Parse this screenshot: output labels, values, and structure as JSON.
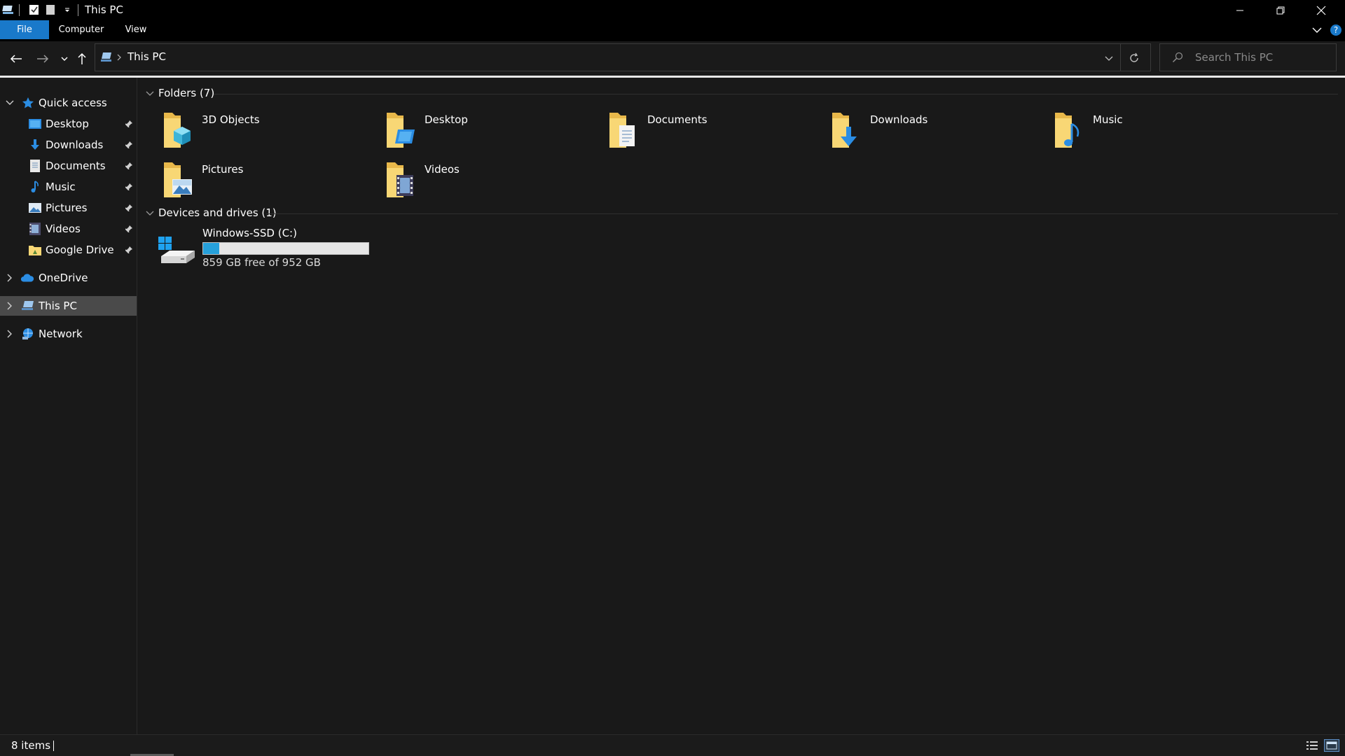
{
  "window": {
    "title": "This PC",
    "controls": {
      "minimize": "minimize-icon",
      "maximize": "restore-icon",
      "close": "close-icon"
    }
  },
  "ribbon": {
    "tabs": [
      {
        "label": "File",
        "active": true
      },
      {
        "label": "Computer",
        "active": false
      },
      {
        "label": "View",
        "active": false
      }
    ]
  },
  "address": {
    "breadcrumb": "This PC",
    "search_placeholder": "Search This PC"
  },
  "sidebar": {
    "quick_access_label": "Quick access",
    "quick_access_items": [
      {
        "label": "Desktop",
        "icon": "desktop-icon",
        "pinned": true
      },
      {
        "label": "Downloads",
        "icon": "downloads-icon",
        "pinned": true
      },
      {
        "label": "Documents",
        "icon": "documents-icon",
        "pinned": true
      },
      {
        "label": "Music",
        "icon": "music-icon",
        "pinned": true
      },
      {
        "label": "Pictures",
        "icon": "pictures-icon",
        "pinned": true
      },
      {
        "label": "Videos",
        "icon": "videos-icon",
        "pinned": true
      },
      {
        "label": "Google Drive",
        "icon": "google-drive-folder-icon",
        "pinned": true
      }
    ],
    "onedrive_label": "OneDrive",
    "this_pc_label": "This PC",
    "network_label": "Network"
  },
  "content": {
    "folders_header": "Folders (7)",
    "folders": [
      {
        "name": "3D Objects",
        "icon": "3d-objects-folder-icon"
      },
      {
        "name": "Desktop",
        "icon": "desktop-folder-icon"
      },
      {
        "name": "Documents",
        "icon": "documents-folder-icon"
      },
      {
        "name": "Downloads",
        "icon": "downloads-folder-icon"
      },
      {
        "name": "Music",
        "icon": "music-folder-icon"
      },
      {
        "name": "Pictures",
        "icon": "pictures-folder-icon"
      },
      {
        "name": "Videos",
        "icon": "videos-folder-icon"
      }
    ],
    "devices_header": "Devices and drives (1)",
    "drive": {
      "name": "Windows-SSD (C:)",
      "free_text": "859 GB free of 952 GB",
      "used_fraction": 0.098
    }
  },
  "status": {
    "item_count": "8 items"
  },
  "colors": {
    "accent": "#1979ca",
    "background": "#191919",
    "folder_yellow": "#f8d775",
    "drive_fill": "#26a0da"
  }
}
